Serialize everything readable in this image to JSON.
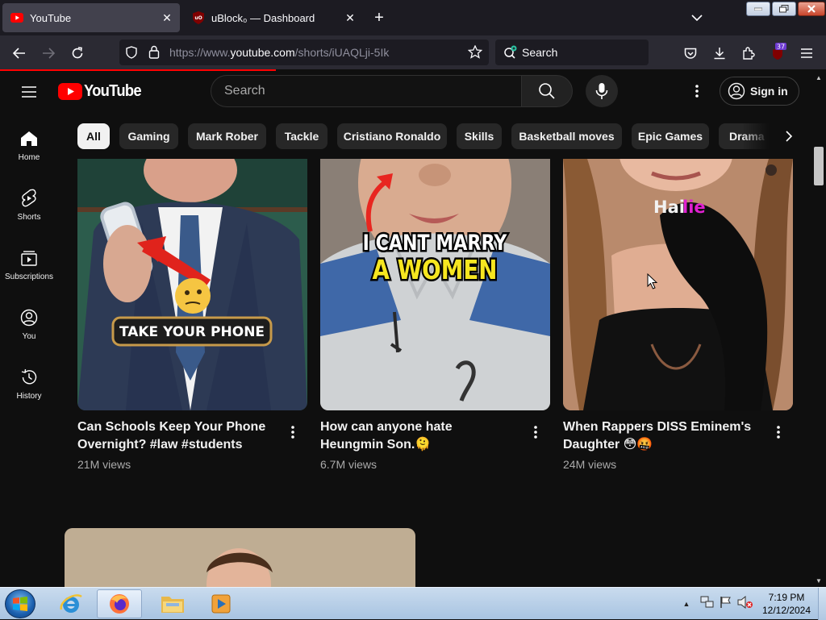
{
  "browser": {
    "tabs": [
      {
        "title": "YouTube",
        "active": true,
        "favicon": "youtube-icon"
      },
      {
        "title": "uBlock₀ — Dashboard",
        "active": false,
        "favicon": "ublock-icon"
      }
    ],
    "url": {
      "prefix": "https://www.",
      "host": "youtube.com",
      "path": "/shorts/iUAQLji-5Ik"
    },
    "search_placeholder": "Search",
    "extension_badge": "37"
  },
  "youtube": {
    "logo_text": "YouTube",
    "search_placeholder": "Search",
    "signin_label": "Sign in",
    "left_nav": [
      {
        "label": "Home",
        "icon": "home-icon"
      },
      {
        "label": "Shorts",
        "icon": "shorts-icon"
      },
      {
        "label": "Subscriptions",
        "icon": "subscriptions-icon"
      },
      {
        "label": "You",
        "icon": "you-icon"
      },
      {
        "label": "History",
        "icon": "history-icon"
      }
    ],
    "chips": [
      "All",
      "Gaming",
      "Mark Rober",
      "Tackle",
      "Cristiano Ronaldo",
      "Skills",
      "Basketball moves",
      "Epic Games",
      "Drama"
    ],
    "selected_chip": "All",
    "shorts": [
      {
        "title": "Can Schools Keep Your Phone Overnight? #law #students",
        "views": "21M views",
        "overlay": "TAKE YOUR PHONE"
      },
      {
        "title": "How can anyone hate Heungmin Son.🫠",
        "views": "6.7M views",
        "overlay_line1": "I CANT MARRY",
        "overlay_line2": "A WOMEN"
      },
      {
        "title": "When Rappers DISS Eminem's Daughter 😳🤬",
        "views": "24M views",
        "overlay_a": "Hai",
        "overlay_b": "lie"
      }
    ]
  },
  "taskbar": {
    "time": "7:19 PM",
    "date": "12/12/2024"
  }
}
